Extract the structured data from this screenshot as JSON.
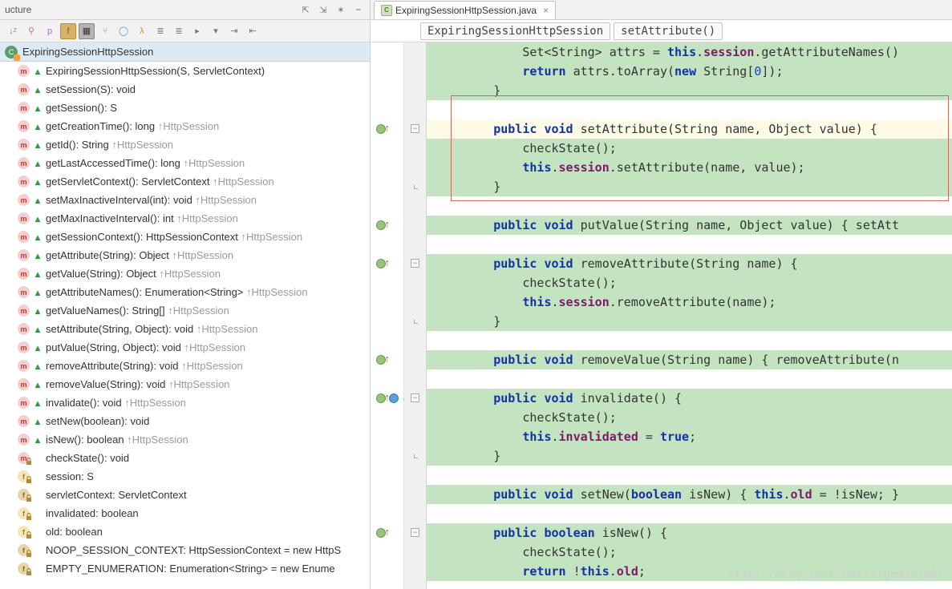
{
  "structure_panel": {
    "title": "ucture",
    "class_name": "ExpiringSessionHttpSession",
    "members": [
      {
        "icon": "m",
        "ov": true,
        "text": "ExpiringSessionHttpSession(S, ServletContext)",
        "inherit": ""
      },
      {
        "icon": "m",
        "ov": true,
        "text": "setSession(S): void",
        "inherit": ""
      },
      {
        "icon": "m",
        "ov": true,
        "text": "getSession(): S",
        "inherit": ""
      },
      {
        "icon": "m",
        "ov": true,
        "text": "getCreationTime(): long ",
        "inherit": "↑HttpSession"
      },
      {
        "icon": "m",
        "ov": true,
        "text": "getId(): String ",
        "inherit": "↑HttpSession"
      },
      {
        "icon": "m",
        "ov": true,
        "text": "getLastAccessedTime(): long ",
        "inherit": "↑HttpSession"
      },
      {
        "icon": "m",
        "ov": true,
        "text": "getServletContext(): ServletContext ",
        "inherit": "↑HttpSession"
      },
      {
        "icon": "m",
        "ov": true,
        "text": "setMaxInactiveInterval(int): void ",
        "inherit": "↑HttpSession"
      },
      {
        "icon": "m",
        "ov": true,
        "text": "getMaxInactiveInterval(): int ",
        "inherit": "↑HttpSession"
      },
      {
        "icon": "m",
        "ov": true,
        "text": "getSessionContext(): HttpSessionContext ",
        "inherit": "↑HttpSession"
      },
      {
        "icon": "m",
        "ov": true,
        "text": "getAttribute(String): Object ",
        "inherit": "↑HttpSession"
      },
      {
        "icon": "m",
        "ov": true,
        "text": "getValue(String): Object ",
        "inherit": "↑HttpSession"
      },
      {
        "icon": "m",
        "ov": true,
        "text": "getAttributeNames(): Enumeration<String> ",
        "inherit": "↑HttpSession"
      },
      {
        "icon": "m",
        "ov": true,
        "text": "getValueNames(): String[] ",
        "inherit": "↑HttpSession"
      },
      {
        "icon": "m",
        "ov": true,
        "text": "setAttribute(String, Object): void ",
        "inherit": "↑HttpSession"
      },
      {
        "icon": "m",
        "ov": true,
        "text": "putValue(String, Object): void ",
        "inherit": "↑HttpSession"
      },
      {
        "icon": "m",
        "ov": true,
        "text": "removeAttribute(String): void ",
        "inherit": "↑HttpSession"
      },
      {
        "icon": "m",
        "ov": true,
        "text": "removeValue(String): void ",
        "inherit": "↑HttpSession"
      },
      {
        "icon": "m",
        "ov": true,
        "text": "invalidate(): void ",
        "inherit": "↑HttpSession"
      },
      {
        "icon": "m",
        "ov": true,
        "text": "setNew(boolean): void",
        "inherit": ""
      },
      {
        "icon": "m",
        "ov": true,
        "text": "isNew(): boolean ",
        "inherit": "↑HttpSession"
      },
      {
        "icon": "m",
        "lock": true,
        "text": "checkState(): void",
        "inherit": ""
      },
      {
        "icon": "f",
        "lock": true,
        "text": "session: S",
        "inherit": ""
      },
      {
        "icon": "s",
        "lock": true,
        "text": "servletContext: ServletContext",
        "inherit": ""
      },
      {
        "icon": "f",
        "lock": true,
        "text": "invalidated: boolean",
        "inherit": ""
      },
      {
        "icon": "f",
        "lock": true,
        "text": "old: boolean",
        "inherit": ""
      },
      {
        "icon": "s",
        "lock": true,
        "text": "NOOP_SESSION_CONTEXT: HttpSessionContext = new HttpS",
        "inherit": ""
      },
      {
        "icon": "s",
        "lock": true,
        "text": "EMPTY_ENUMERATION: Enumeration<String> = new Enume",
        "inherit": ""
      }
    ]
  },
  "editor": {
    "tab_name": "ExpiringSessionHttpSession.java",
    "breadcrumb_class": "ExpiringSessionHttpSession",
    "breadcrumb_method": "setAttribute()",
    "watermark": "http://blog.csdn.net/xlgen157387",
    "lines": [
      {
        "raw": "            Set<String> attrs = this.session.getAttributeNames()",
        "tokens": [
          [
            "            Set<String> attrs = ",
            ""
          ],
          [
            "this",
            "kw"
          ],
          [
            ".",
            ""
          ],
          [
            "session",
            "field"
          ],
          [
            ".getAttributeNames()",
            ""
          ]
        ]
      },
      {
        "raw": "            return attrs.toArray(new String[0]);",
        "tokens": [
          [
            "            ",
            ""
          ],
          [
            "return",
            "kw"
          ],
          [
            " attrs.toArray(",
            ""
          ],
          [
            "new",
            "kw"
          ],
          [
            " String[",
            ""
          ],
          [
            "0",
            "num"
          ],
          [
            "]);",
            ""
          ]
        ]
      },
      {
        "raw": "        }",
        "tokens": [
          [
            "        }",
            ""
          ]
        ]
      },
      {
        "raw": "",
        "tokens": [
          [
            "",
            ""
          ]
        ],
        "blank": true
      },
      {
        "raw": "        public void setAttribute(String name, Object value) {",
        "tokens": [
          [
            "        ",
            ""
          ],
          [
            "public",
            "kw"
          ],
          [
            " ",
            ""
          ],
          [
            "void",
            "kw"
          ],
          [
            " setAttribute(String name, Object value) {",
            ""
          ]
        ],
        "hl": true,
        "gutterBall": true,
        "gutterArrow": true,
        "foldOpen": true
      },
      {
        "raw": "            checkState();",
        "tokens": [
          [
            "            checkState();",
            ""
          ]
        ]
      },
      {
        "raw": "            this.session.setAttribute(name, value);",
        "tokens": [
          [
            "            ",
            ""
          ],
          [
            "this",
            "kw"
          ],
          [
            ".",
            ""
          ],
          [
            "session",
            "field"
          ],
          [
            ".setAttribute(name, value);",
            ""
          ]
        ]
      },
      {
        "raw": "        }",
        "tokens": [
          [
            "        }",
            ""
          ]
        ],
        "foldClose": true
      },
      {
        "raw": "",
        "tokens": [
          [
            "",
            ""
          ]
        ],
        "blank": true
      },
      {
        "raw": "        public void putValue(String name, Object value) { setAtt",
        "tokens": [
          [
            "        ",
            ""
          ],
          [
            "public",
            "kw"
          ],
          [
            " ",
            ""
          ],
          [
            "void",
            "kw"
          ],
          [
            " putValue(String name, Object value) ",
            ""
          ],
          [
            "{",
            "nochange"
          ],
          [
            " setAtt",
            ""
          ]
        ],
        "gutterBall": true,
        "gutterArrow": true
      },
      {
        "raw": "",
        "tokens": [
          [
            "",
            ""
          ]
        ],
        "blank": true
      },
      {
        "raw": "        public void removeAttribute(String name) {",
        "tokens": [
          [
            "        ",
            ""
          ],
          [
            "public",
            "kw"
          ],
          [
            " ",
            ""
          ],
          [
            "void",
            "kw"
          ],
          [
            " removeAttribute(String name) {",
            ""
          ]
        ],
        "gutterBall": true,
        "gutterArrow": true,
        "foldOpen": true
      },
      {
        "raw": "            checkState();",
        "tokens": [
          [
            "            checkState();",
            ""
          ]
        ]
      },
      {
        "raw": "            this.session.removeAttribute(name);",
        "tokens": [
          [
            "            ",
            ""
          ],
          [
            "this",
            "kw"
          ],
          [
            ".",
            ""
          ],
          [
            "session",
            "field"
          ],
          [
            ".removeAttribute(name);",
            ""
          ]
        ]
      },
      {
        "raw": "        }",
        "tokens": [
          [
            "        }",
            ""
          ]
        ],
        "foldClose": true
      },
      {
        "raw": "",
        "tokens": [
          [
            "",
            ""
          ]
        ],
        "blank": true
      },
      {
        "raw": "        public void removeValue(String name) { removeAttribute(n",
        "tokens": [
          [
            "        ",
            ""
          ],
          [
            "public",
            "kw"
          ],
          [
            " ",
            ""
          ],
          [
            "void",
            "kw"
          ],
          [
            " removeValue(String name) ",
            ""
          ],
          [
            "{",
            "nochange"
          ],
          [
            " removeAttribute(n",
            ""
          ]
        ],
        "gutterBall": true,
        "gutterArrow": true
      },
      {
        "raw": "",
        "tokens": [
          [
            "",
            ""
          ]
        ],
        "blank": true
      },
      {
        "raw": "        public void invalidate() {",
        "tokens": [
          [
            "        ",
            ""
          ],
          [
            "public",
            "kw"
          ],
          [
            " ",
            ""
          ],
          [
            "void",
            "kw"
          ],
          [
            " invalidate() {",
            ""
          ]
        ],
        "gutterBall": true,
        "gutterArrow": true,
        "gutterBlue": true,
        "foldOpen": true
      },
      {
        "raw": "            checkState();",
        "tokens": [
          [
            "            checkState();",
            ""
          ]
        ]
      },
      {
        "raw": "            this.invalidated = true;",
        "tokens": [
          [
            "            ",
            ""
          ],
          [
            "this",
            "kw"
          ],
          [
            ".",
            ""
          ],
          [
            "invalidated",
            "field"
          ],
          [
            " = ",
            ""
          ],
          [
            "true",
            "kw"
          ],
          [
            ";",
            ""
          ]
        ]
      },
      {
        "raw": "        }",
        "tokens": [
          [
            "        }",
            ""
          ]
        ],
        "foldClose": true
      },
      {
        "raw": "",
        "tokens": [
          [
            "",
            ""
          ]
        ],
        "blank": true
      },
      {
        "raw": "        public void setNew(boolean isNew) { this.old = !isNew; }",
        "tokens": [
          [
            "        ",
            ""
          ],
          [
            "public",
            "kw"
          ],
          [
            " ",
            ""
          ],
          [
            "void",
            "kw"
          ],
          [
            " setNew(",
            ""
          ],
          [
            "boolean",
            "kw"
          ],
          [
            " isNew) ",
            ""
          ],
          [
            "{",
            "nochange"
          ],
          [
            " ",
            ""
          ],
          [
            "this",
            "kw"
          ],
          [
            ".",
            ""
          ],
          [
            "old",
            "field"
          ],
          [
            " = !isNew; ",
            ""
          ],
          [
            "}",
            "nochange"
          ]
        ]
      },
      {
        "raw": "",
        "tokens": [
          [
            "",
            ""
          ]
        ],
        "blank": true
      },
      {
        "raw": "        public boolean isNew() {",
        "tokens": [
          [
            "        ",
            ""
          ],
          [
            "public",
            "kw"
          ],
          [
            " ",
            ""
          ],
          [
            "boolean",
            "kw"
          ],
          [
            " isNew() {",
            ""
          ]
        ],
        "gutterBall": true,
        "gutterArrow": true,
        "foldOpen": true
      },
      {
        "raw": "            checkState();",
        "tokens": [
          [
            "            checkState();",
            ""
          ]
        ]
      },
      {
        "raw": "            return !this.old;",
        "tokens": [
          [
            "            ",
            ""
          ],
          [
            "return",
            "kw"
          ],
          [
            " !",
            ""
          ],
          [
            "this",
            "kw"
          ],
          [
            ".",
            ""
          ],
          [
            "old",
            "field"
          ],
          [
            ";",
            ""
          ]
        ]
      }
    ],
    "highlight_box": {
      "top_line": 3,
      "bottom_line": 8
    }
  }
}
